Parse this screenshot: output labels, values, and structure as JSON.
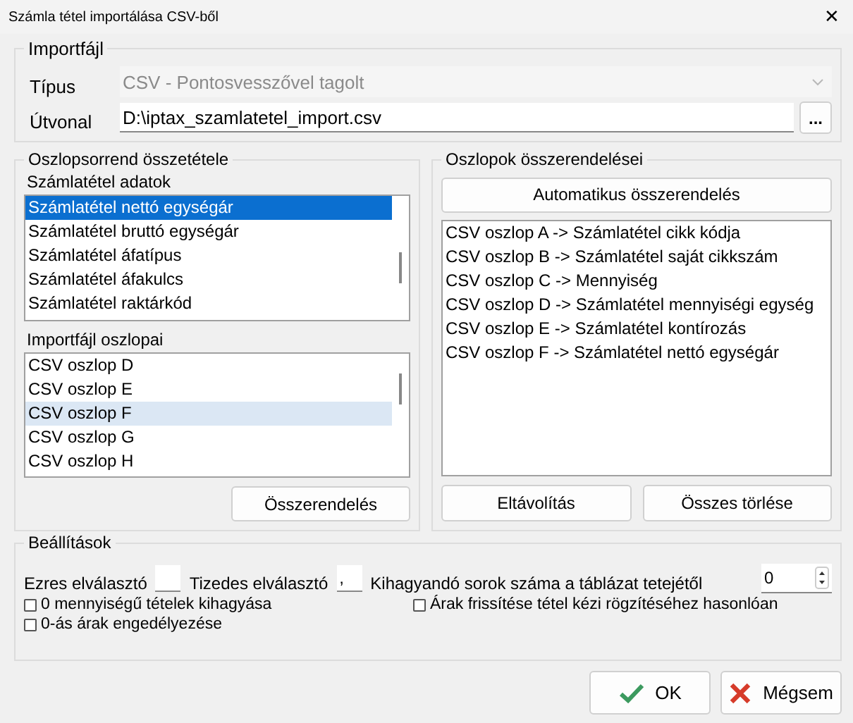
{
  "window": {
    "title": "Számla tétel importálása CSV-ből",
    "close": "✕"
  },
  "import_file": {
    "title": "Importfájl",
    "type_label": "Típus",
    "type_value": "CSV - Pontosvesszővel tagolt",
    "type_disabled": true,
    "path_label": "Útvonal",
    "path_value": "D:\\iptax_szamlatetel_import.csv",
    "browse_button": "..."
  },
  "column_order": {
    "title": "Oszlopsorrend összetétele",
    "invoice_fields_label": "Számlatétel adatok",
    "invoice_fields": [
      {
        "label": "Számlatétel nettó egységár",
        "selected": true
      },
      {
        "label": "Számlatétel bruttó egységár",
        "selected": false
      },
      {
        "label": "Számlatétel áfatípus",
        "selected": false
      },
      {
        "label": "Számlatétel áfakulcs",
        "selected": false
      },
      {
        "label": "Számlatétel raktárkód",
        "selected": false
      }
    ],
    "file_columns_label": "Importfájl oszlopai",
    "file_columns": [
      {
        "label": "CSV oszlop D",
        "selected": false
      },
      {
        "label": "CSV oszlop E",
        "selected": false
      },
      {
        "label": "CSV oszlop F",
        "selected": true
      },
      {
        "label": "CSV oszlop G",
        "selected": false
      },
      {
        "label": "CSV oszlop H",
        "selected": false
      }
    ],
    "assign_button": "Összerendelés"
  },
  "mappings": {
    "title": "Oszlopok összerendelései",
    "auto_button": "Automatikus összerendelés",
    "items": [
      {
        "label": "CSV oszlop A -> Számlatétel cikk kódja",
        "selected": false
      },
      {
        "label": "CSV oszlop B -> Számlatétel saját cikkszám",
        "selected": false
      },
      {
        "label": "CSV oszlop C -> Mennyiség",
        "selected": false
      },
      {
        "label": "CSV oszlop D -> Számlatétel mennyiségi egység",
        "selected": false
      },
      {
        "label": "CSV oszlop E -> Számlatétel kontírozás",
        "selected": false
      },
      {
        "label": "CSV oszlop F -> Számlatétel nettó egységár",
        "selected": false
      }
    ],
    "remove_button": "Eltávolítás",
    "clear_button": "Összes törlése"
  },
  "settings": {
    "title": "Beállítások",
    "thousands_label": "Ezres elválasztó",
    "decimal_label": "Tizedes elválasztó",
    "decimal_value": ",",
    "skip_rows_label": "Kihagyandó sorok száma a táblázat tetejétől",
    "skip_rows_value": "0",
    "checkboxes_left": [
      {
        "label": "0 mennyiségű tételek kihagyása",
        "checked": false
      },
      {
        "label": "0-ás árak engedélyezése",
        "checked": false
      }
    ],
    "checkboxes_right": [
      {
        "label": "Árak frissítése tétel kézi rögzítéséhez hasonlóan",
        "checked": false
      }
    ]
  },
  "buttons": [
    {
      "kind": "ok",
      "label": "OK"
    },
    {
      "kind": "cancel",
      "label": "Mégsem"
    }
  ]
}
